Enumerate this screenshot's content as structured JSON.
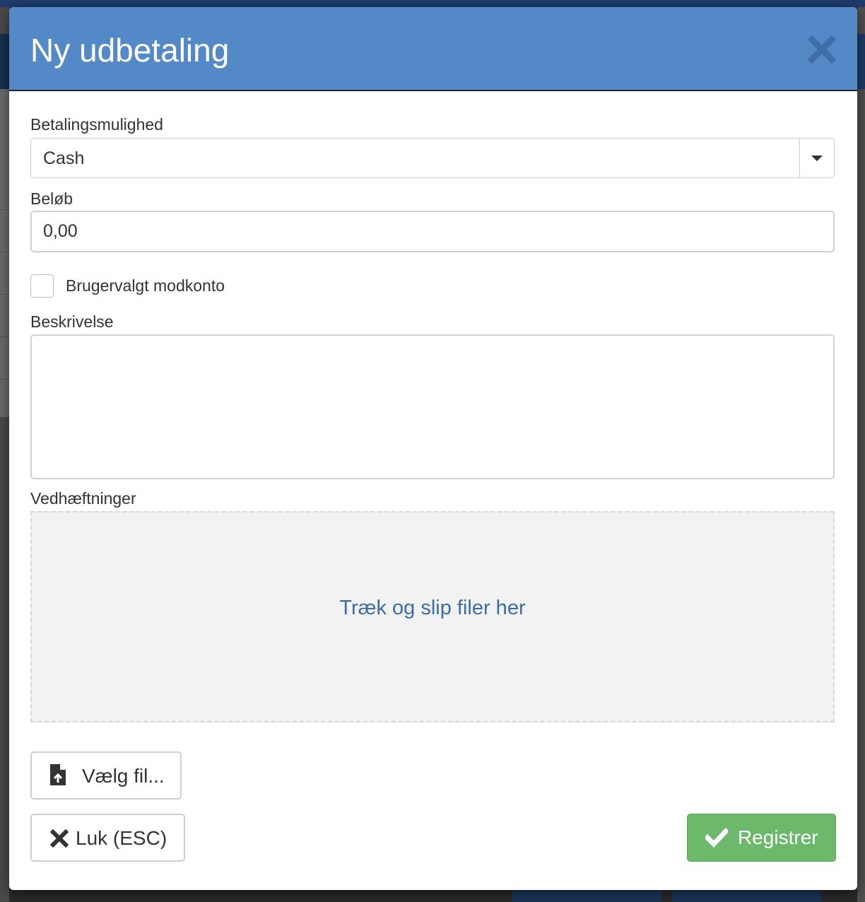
{
  "modal": {
    "title": "Ny udbetaling",
    "close_icon": "times-icon"
  },
  "form": {
    "payment_option": {
      "label": "Betalingsmulighed",
      "selected": "Cash"
    },
    "amount": {
      "label": "Beløb",
      "value": "0,00"
    },
    "custom_account": {
      "label": "Brugervalgt modkonto",
      "checked": false
    },
    "description": {
      "label": "Beskrivelse",
      "value": ""
    },
    "attachments": {
      "label": "Vedhæftninger",
      "dropzone_text": "Træk og slip filer her"
    }
  },
  "buttons": {
    "choose_file": "Vælg fil...",
    "close": "Luk (ESC)",
    "register": "Registrer"
  },
  "colors": {
    "header": "#5389c6",
    "register": "#6cb96c",
    "dropzone_text": "#3a6ea5"
  }
}
